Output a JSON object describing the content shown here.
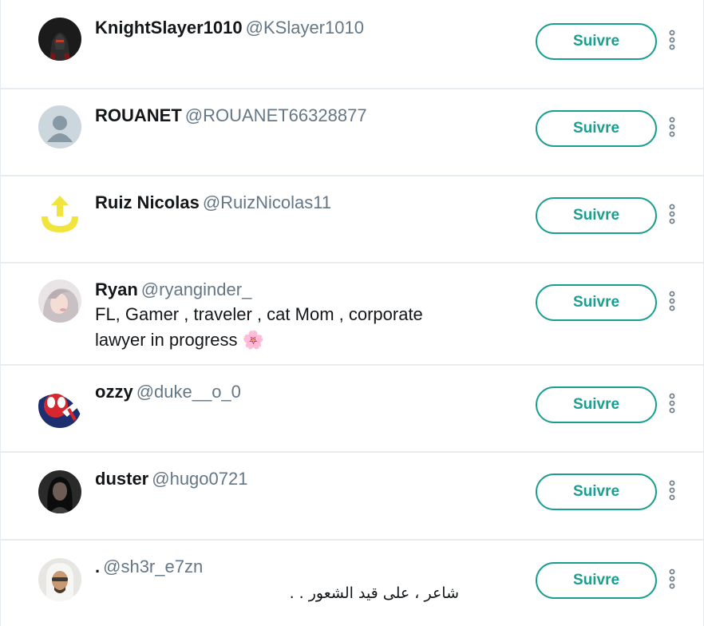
{
  "accent_color": "#1a9e8f",
  "users": [
    {
      "name": "KnightSlayer1010",
      "handle": "@KSlayer1010",
      "bio": "",
      "follow_label": "Suivre",
      "avatar_icon": "knight-avatar-icon"
    },
    {
      "name": "ROUANET",
      "handle": "@ROUANET66328877",
      "bio": "",
      "follow_label": "Suivre",
      "avatar_icon": "default-profile-icon"
    },
    {
      "name": "Ruiz Nicolas",
      "handle": "@RuizNicolas11",
      "bio": "",
      "follow_label": "Suivre",
      "avatar_icon": "yellow-arrow-logo-icon"
    },
    {
      "name": "Ryan",
      "handle": "@ryanginder_",
      "bio_line1": "FL, Gamer , traveler , cat Mom , corporate",
      "bio_line2": "lawyer in progress 🌸",
      "follow_label": "Suivre",
      "avatar_icon": "person-photo-icon"
    },
    {
      "name": "ozzy",
      "handle": "@duke__o_0",
      "bio": "",
      "follow_label": "Suivre",
      "avatar_icon": "spider-character-icon"
    },
    {
      "name": "duster",
      "handle": "@hugo0721",
      "bio": "",
      "follow_label": "Suivre",
      "avatar_icon": "dark-photo-icon"
    },
    {
      "name": ".",
      "handle": "@sh3r_e7zn",
      "bio": "شاعر ، على قيد الشعور . .",
      "follow_label": "Suivre",
      "avatar_icon": "man-photo-icon"
    }
  ]
}
